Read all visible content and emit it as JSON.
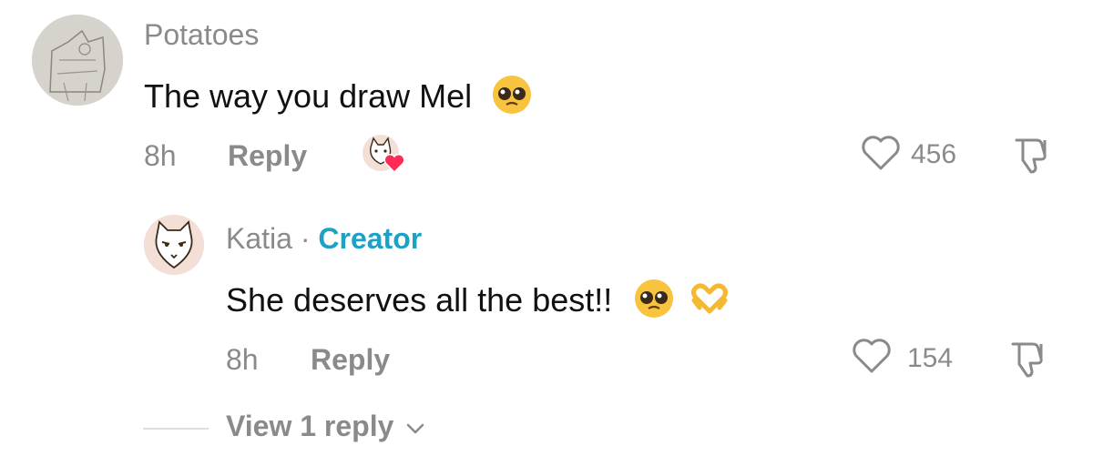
{
  "comment": {
    "username": "Potatoes",
    "text": "The way you draw Mel",
    "time": "8h",
    "reply_label": "Reply",
    "likes": "456"
  },
  "reply": {
    "username": "Katia",
    "separator": "·",
    "badge": "Creator",
    "text": "She deserves all the best!!",
    "time": "8h",
    "reply_label": "Reply",
    "likes": "154"
  },
  "view_replies": "View 1 reply",
  "colors": {
    "creator_badge": "#1da1c6",
    "like_heart": "#fe2c55",
    "muted_text": "#8a8a8a"
  },
  "icons": [
    "heart-outline-icon",
    "thumbs-down-icon",
    "chevron-down-icon",
    "creator-liked-heart-icon",
    "pleading-face-emoji",
    "heart-hands-emoji"
  ]
}
